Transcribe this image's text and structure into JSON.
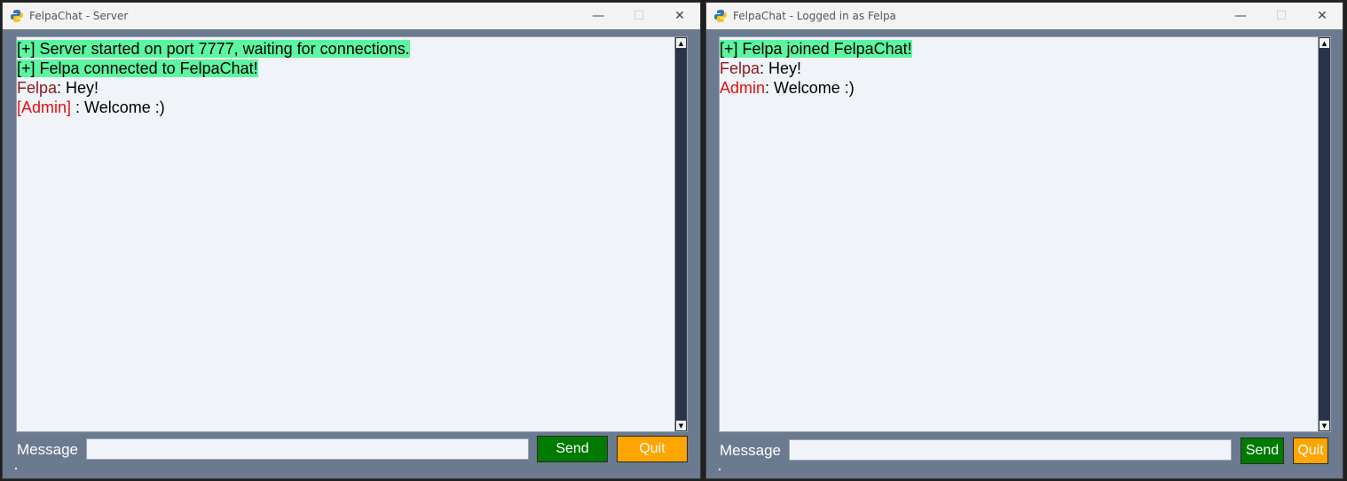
{
  "server_window": {
    "title": "FelpaChat - Server",
    "controls": {
      "minimize": "—",
      "maximize": "☐",
      "close": "✕"
    },
    "messages": [
      {
        "kind": "system",
        "text": "[+] Server started on port 7777, waiting for connections."
      },
      {
        "kind": "system",
        "text": "[+] Felpa connected to FelpaChat!"
      },
      {
        "kind": "user",
        "name": "Felpa",
        "text": ": Hey!"
      },
      {
        "kind": "admin",
        "name": "[Admin]",
        "text": " : Welcome :)"
      }
    ],
    "message_label": "Message",
    "message_value": "",
    "send_label": "Send",
    "quit_label": "Quit"
  },
  "client_window": {
    "title": "FelpaChat - Logged in as Felpa",
    "controls": {
      "minimize": "—",
      "maximize": "☐",
      "close": "✕"
    },
    "messages": [
      {
        "kind": "system",
        "text": "[+] Felpa joined FelpaChat!"
      },
      {
        "kind": "user",
        "name": "Felpa",
        "text": ": Hey!"
      },
      {
        "kind": "admin",
        "name": "Admin",
        "text": ": Welcome :)"
      }
    ],
    "message_label": "Message",
    "message_value": "",
    "send_label": "Send",
    "quit_label": "Quit"
  },
  "colors": {
    "window_bg": "#6b7a8f",
    "chat_bg": "#f0f3f8",
    "system_highlight": "#5cf5a0",
    "username": "#8b1a1a",
    "admin": "#e01010",
    "send_button": "#007a00",
    "quit_button": "#ffa500",
    "scrollbar": "#2a3448"
  },
  "icons": {
    "app": "python-icon",
    "scroll_up": "arrow-up-icon",
    "scroll_down": "arrow-down-icon"
  }
}
